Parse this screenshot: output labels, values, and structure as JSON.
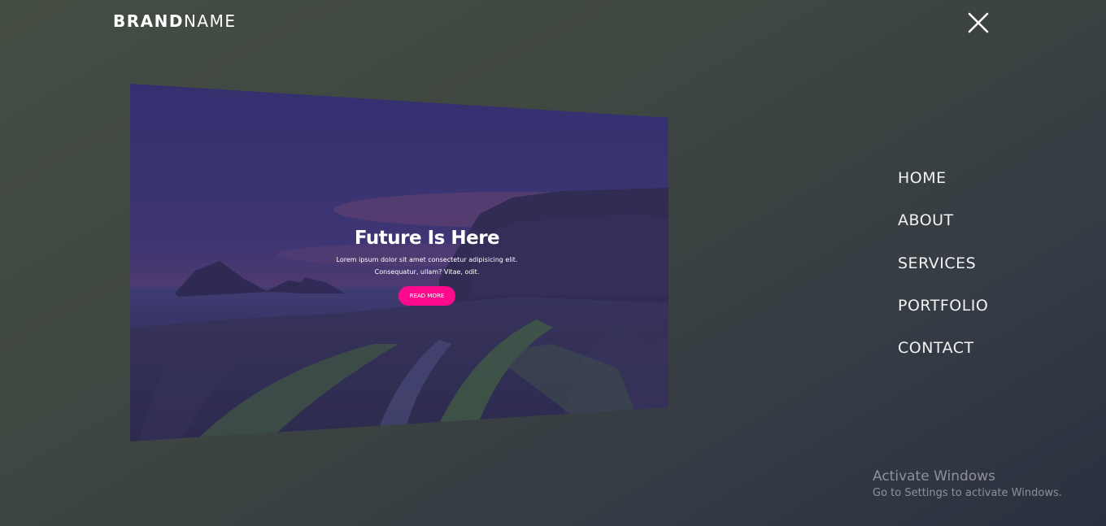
{
  "header": {
    "brand_bold": "BRAND",
    "brand_light": "NAME",
    "close_icon": "close-icon"
  },
  "hero": {
    "title": "Future Is Here",
    "text_line1": "Lorem ipsum dolor sit amet consectetur adipisicing elit.",
    "text_line2": "Consequatur, ullam? Vitae, odit.",
    "button_label": "READ MORE",
    "button_color": "#ff0a8c"
  },
  "nav": {
    "items": [
      {
        "label": "HOME"
      },
      {
        "label": "ABOUT"
      },
      {
        "label": "SERVICES"
      },
      {
        "label": "PORTFOLIO"
      },
      {
        "label": "CONTACT"
      }
    ]
  },
  "watermark": {
    "title": "Activate Windows",
    "subtitle": "Go to Settings to activate Windows."
  },
  "colors": {
    "background_start": "#444d42",
    "background_end": "#2b303f",
    "accent": "#ff0a8c"
  }
}
